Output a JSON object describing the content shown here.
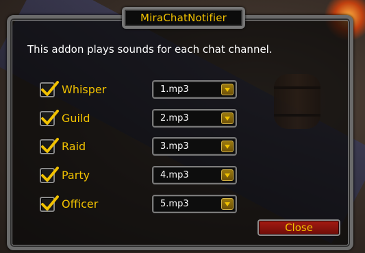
{
  "window": {
    "title": "MiraChatNotifier",
    "description": "This addon plays sounds for each chat channel."
  },
  "channels": [
    {
      "label": "Whisper",
      "checked": true,
      "sound": "1.mp3"
    },
    {
      "label": "Guild",
      "checked": true,
      "sound": "2.mp3"
    },
    {
      "label": "Raid",
      "checked": true,
      "sound": "3.mp3"
    },
    {
      "label": "Party",
      "checked": true,
      "sound": "4.mp3"
    },
    {
      "label": "Officer",
      "checked": true,
      "sound": "5.mp3"
    }
  ],
  "buttons": {
    "close_label": "Close"
  },
  "icons": {
    "checkbox": "checkmark-icon",
    "dropdown": "chevron-down-icon"
  },
  "colors": {
    "gold_text": "#f2c200",
    "close_button": "#a51b12",
    "frame": "#6b6b6b"
  }
}
